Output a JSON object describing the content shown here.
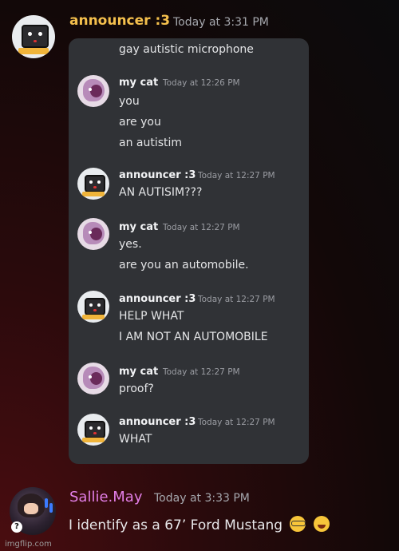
{
  "top_message": {
    "author": "announcer :3",
    "timestamp": "Today at 3:31 PM",
    "author_color": "#f5c04d"
  },
  "embed": {
    "first_line": "gay autistic microphone",
    "groups": [
      {
        "author": "my cat",
        "timestamp": "Today at 12:26 PM",
        "lines": [
          "you",
          "are you",
          "an autistim"
        ]
      },
      {
        "author": "announcer :3",
        "timestamp": "Today at 12:27 PM",
        "lines": [
          "AN AUTISIM???"
        ]
      },
      {
        "author": "my cat",
        "timestamp": "Today at 12:27 PM",
        "lines": [
          "yes.",
          "are you an automobile."
        ]
      },
      {
        "author": "announcer :3",
        "timestamp": "Today at 12:27 PM",
        "lines": [
          "HELP WHAT",
          "I AM NOT AN AUTOMOBILE"
        ]
      },
      {
        "author": "my cat",
        "timestamp": "Today at 12:27 PM",
        "lines": [
          "proof?"
        ]
      },
      {
        "author": "announcer :3",
        "timestamp": "Today at 12:27 PM",
        "lines": [
          "WHAT"
        ]
      }
    ]
  },
  "bottom_message": {
    "author": "Sallie.May",
    "timestamp": "Today at 3:33 PM",
    "text": "I identify as a 67’ Ford Mustang",
    "emojis": [
      "nerd-face",
      "tears-of-joy"
    ],
    "author_color": "#e27ee6",
    "badge": "?"
  },
  "watermark": "imgflip.com"
}
